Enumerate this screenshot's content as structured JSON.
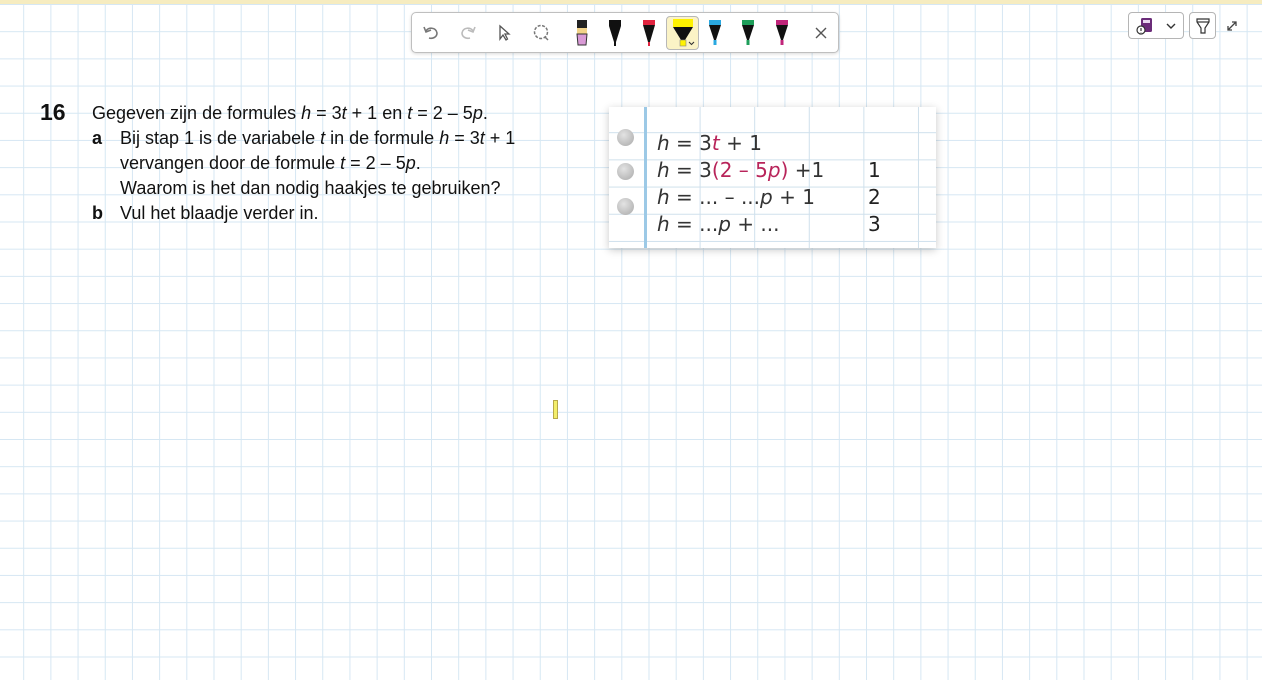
{
  "toolbar": {
    "tools": [
      "undo-icon",
      "redo-icon",
      "pointer-icon",
      "lasso-icon",
      "pink-marker-icon",
      "black-marker-icon",
      "red-marker-icon",
      "yellow-highlighter-icon",
      "blue-marker-icon",
      "green-marker-icon",
      "magenta-marker-icon",
      "close-icon"
    ],
    "active_tool": "yellow-highlighter-icon",
    "colors": {
      "pink": "#d99ad6",
      "black": "#111111",
      "red": "#e0243f",
      "yellow": "#fff200",
      "blue": "#2aa8e0",
      "green": "#1e9e5a",
      "magenta": "#c0257a"
    }
  },
  "exercise": {
    "number": "16",
    "intro": {
      "pre": "Gegeven zijn de formules ",
      "v1": "h",
      "mid1": " = 3",
      "v2": "t",
      "mid2": " + 1 en ",
      "v3": "t",
      "mid3": " = 2 – 5",
      "v4": "p",
      "post": "."
    },
    "a": {
      "label": "a",
      "l1": {
        "pre": "Bij stap 1 is de variabele ",
        "v1": "t",
        "mid": " in de formule ",
        "v2": "h",
        "m2": " = 3",
        "v3": "t",
        "post": " + 1"
      },
      "l2": {
        "pre": "vervangen door de formule ",
        "v1": "t",
        "mid": " = 2 – 5",
        "v2": "p",
        "post": "."
      },
      "l3": "Waarom is het dan nodig haakjes te gebruiken?"
    },
    "b": {
      "label": "b",
      "text": "Vul het blaadje verder in."
    }
  },
  "blaadje": {
    "r1": {
      "v": "h",
      "eq": " = 3",
      "t": "t",
      "post": " + 1"
    },
    "r2": {
      "v": "h",
      "eq": " = 3",
      "open": "(",
      "inner": "2 – 5",
      "p": "p",
      "close": ")",
      "post": " +1"
    },
    "r3": {
      "v": "h",
      "eq": " = ... – ...",
      "p": "p",
      "post": " + 1"
    },
    "r4": {
      "v": "h",
      "eq": " = ...",
      "p": "p",
      "post": " + ..."
    },
    "steps": [
      "1",
      "2",
      "3"
    ]
  }
}
